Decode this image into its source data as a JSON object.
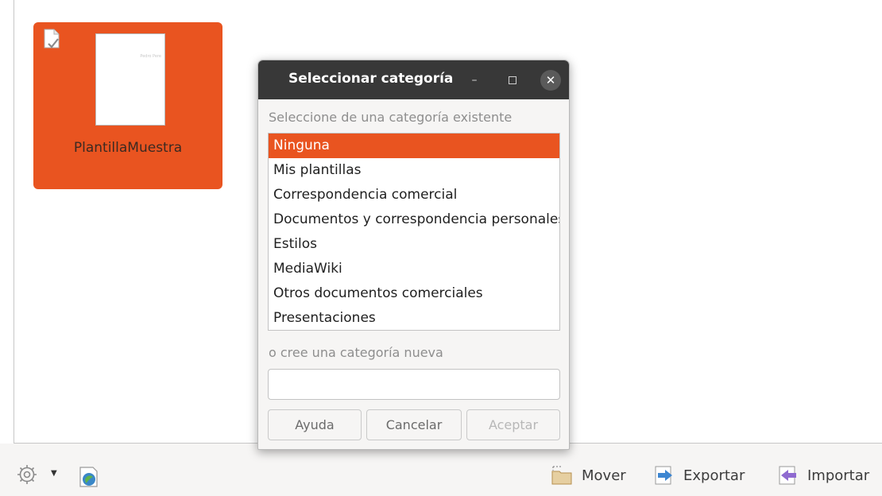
{
  "template_tile": {
    "name": "PlantillaMuestra",
    "thumbnail_text": "Pedro Pere"
  },
  "dialog": {
    "title": "Seleccionar categoría",
    "label_existing": "Seleccione de una categoría existente",
    "categories": [
      "Ninguna",
      "Mis plantillas",
      "Correspondencia comercial",
      "Documentos y correspondencia personales",
      "Estilos",
      "MediaWiki",
      "Otros documentos comerciales",
      "Presentaciones"
    ],
    "selected_index": 0,
    "label_new": "o cree una categoría nueva",
    "new_category_value": "",
    "buttons": {
      "help": "Ayuda",
      "cancel": "Cancelar",
      "ok": "Aceptar"
    },
    "accent_color": "#E95420"
  },
  "toolbar": {
    "settings_icon": "gear-icon",
    "repository_icon": "template-repository-icon",
    "move_label": "Mover",
    "export_label": "Exportar",
    "import_label": "Importar"
  }
}
